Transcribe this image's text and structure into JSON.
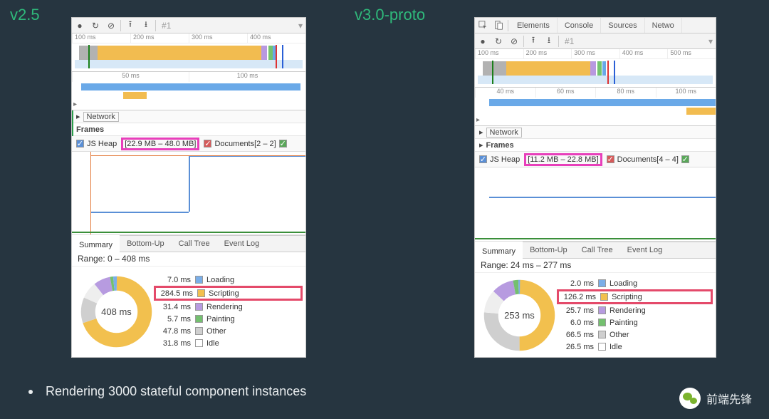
{
  "labels": {
    "v25": "v2.5",
    "v30": "v3.0-proto"
  },
  "devtools_tabs": [
    "Elements",
    "Console",
    "Sources",
    "Netwo"
  ],
  "toolbar": {
    "session": "#1"
  },
  "left": {
    "overview_ticks": [
      "100 ms",
      "200 ms",
      "300 ms",
      "400 ms"
    ],
    "flame_ticks": [
      "50 ms",
      "100 ms"
    ],
    "tree": {
      "network": "Network",
      "frames": "Frames"
    },
    "memory": {
      "jsheap_label": "JS Heap",
      "jsheap_range": "[22.9 MB – 48.0 MB]",
      "documents": "Documents[2 – 2]"
    },
    "tabs": [
      "Summary",
      "Bottom-Up",
      "Call Tree",
      "Event Log"
    ],
    "range": "Range: 0 – 408 ms",
    "total": "408 ms",
    "legend": [
      {
        "val": "7.0 ms",
        "label": "Loading",
        "color": "#7aaee8"
      },
      {
        "val": "284.5 ms",
        "label": "Scripting",
        "color": "#f2c04e",
        "hl": true
      },
      {
        "val": "31.4 ms",
        "label": "Rendering",
        "color": "#b79be0"
      },
      {
        "val": "5.7 ms",
        "label": "Painting",
        "color": "#74c06f"
      },
      {
        "val": "47.8 ms",
        "label": "Other",
        "color": "#cfcfcf"
      },
      {
        "val": "31.8 ms",
        "label": "Idle",
        "color": "#ffffff"
      }
    ]
  },
  "right": {
    "overview_ticks": [
      "100 ms",
      "200 ms",
      "300 ms",
      "400 ms",
      "500 ms"
    ],
    "flame_ticks": [
      "40 ms",
      "60 ms",
      "80 ms",
      "100 ms"
    ],
    "tree": {
      "network": "Network",
      "frames": "Frames"
    },
    "memory": {
      "jsheap_label": "JS Heap",
      "jsheap_range": "[11.2 MB – 22.8 MB]",
      "documents": "Documents[4 – 4]"
    },
    "tabs": [
      "Summary",
      "Bottom-Up",
      "Call Tree",
      "Event Log"
    ],
    "range": "Range: 24 ms – 277 ms",
    "total": "253 ms",
    "legend": [
      {
        "val": "2.0 ms",
        "label": "Loading",
        "color": "#7aaee8"
      },
      {
        "val": "126.2 ms",
        "label": "Scripting",
        "color": "#f2c04e",
        "hl": true
      },
      {
        "val": "25.7 ms",
        "label": "Rendering",
        "color": "#b79be0"
      },
      {
        "val": "6.0 ms",
        "label": "Painting",
        "color": "#74c06f"
      },
      {
        "val": "66.5 ms",
        "label": "Other",
        "color": "#cfcfcf"
      },
      {
        "val": "26.5 ms",
        "label": "Idle",
        "color": "#ffffff"
      }
    ]
  },
  "caption": "Rendering 3000 stateful component instances",
  "watermark": "前端先锋",
  "chart_data": [
    {
      "type": "pie",
      "title": "v2.5 summary — 408 ms total",
      "categories": [
        "Loading",
        "Scripting",
        "Rendering",
        "Painting",
        "Other",
        "Idle"
      ],
      "values": [
        7.0,
        284.5,
        31.4,
        5.7,
        47.8,
        31.8
      ],
      "unit": "ms"
    },
    {
      "type": "pie",
      "title": "v3.0-proto summary — 253 ms total",
      "categories": [
        "Loading",
        "Scripting",
        "Rendering",
        "Painting",
        "Other",
        "Idle"
      ],
      "values": [
        2.0,
        126.2,
        25.7,
        6.0,
        66.5,
        26.5
      ],
      "unit": "ms"
    }
  ]
}
